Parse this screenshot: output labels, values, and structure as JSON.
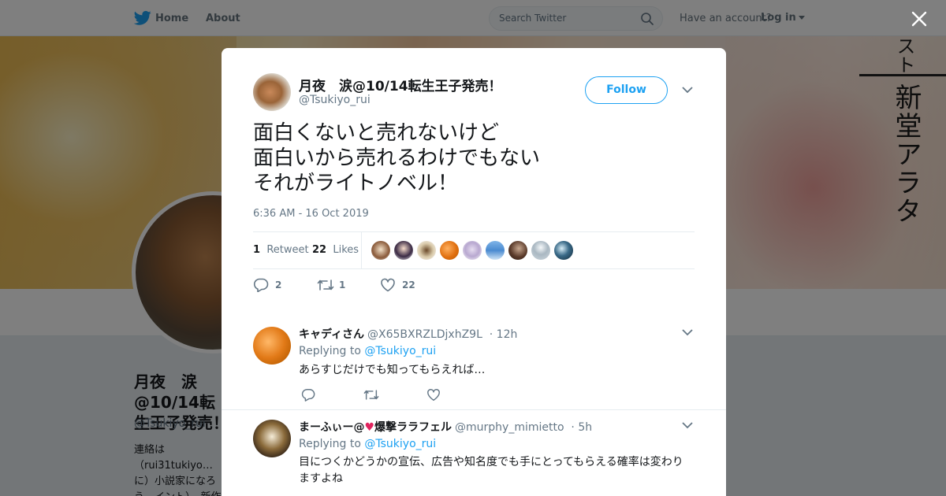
{
  "nav": {
    "home": "Home",
    "about": "About",
    "search_placeholder": "Search Twitter",
    "have_account": "Have an account?",
    "login": "Log in",
    "brand_color": "#1da1f2"
  },
  "banner": {
    "vertical_text_top": "スト",
    "vertical_text": "新堂アラタ"
  },
  "profile": {
    "name": "月夜　涙@10/14転生王子発売！",
    "handle": "@Tsukiyo_rui",
    "bio": "連絡は（rui31tukiyo…に）小説家になろう…イント）　新作ラ…代表作は【回復術士"
  },
  "tweet": {
    "author_name": "月夜　涙@10/14転生王子発売！",
    "author_handle": "@Tsukiyo_rui",
    "follow_label": "Follow",
    "text_lines": [
      "面白くないと売れないけど",
      "面白いから売れるわけでもない",
      "それがライトノベル！"
    ],
    "timestamp": "6:36 AM - 16 Oct 2019",
    "retweet_count": "1",
    "retweet_label": "Retweet",
    "like_count": "22",
    "like_label": "Likes",
    "actions": {
      "reply_count": "2",
      "retweet_count": "1",
      "like_count": "22"
    }
  },
  "replies": [
    {
      "name": "キャディさん",
      "handle": "@X65BXRZLDjxhZ9L",
      "time": "· 12h",
      "replying_label": "Replying to",
      "replying_to": "@Tsukiyo_rui",
      "text": "あらすじだけでも知ってもらえれば…"
    },
    {
      "name_prefix": "まーふぃー@",
      "name_heart": "♥",
      "name_suffix": "爆撃ララフェル",
      "handle": "@murphy_mimietto",
      "time": "· 5h",
      "replying_label": "Replying to",
      "replying_to": "@Tsukiyo_rui",
      "text": "目につくかどうかの宣伝、広告や知名度でも手にとってもらえる確率は変わりますよね"
    }
  ]
}
